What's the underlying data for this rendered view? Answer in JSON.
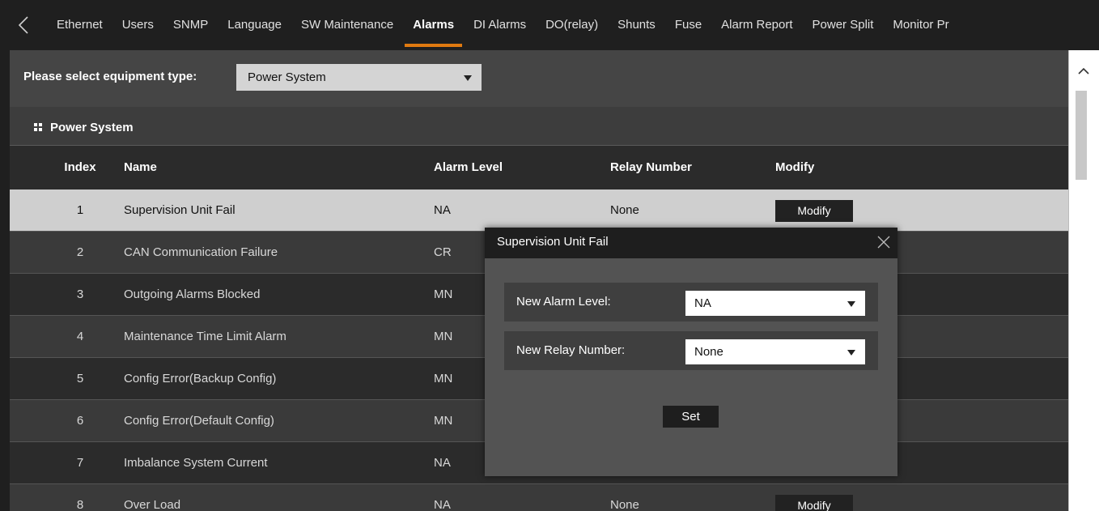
{
  "nav": {
    "tabs": [
      {
        "label": "Ethernet",
        "active": false
      },
      {
        "label": "Users",
        "active": false
      },
      {
        "label": "SNMP",
        "active": false
      },
      {
        "label": "Language",
        "active": false
      },
      {
        "label": "SW Maintenance",
        "active": false
      },
      {
        "label": "Alarms",
        "active": true
      },
      {
        "label": "DI Alarms",
        "active": false
      },
      {
        "label": "DO(relay)",
        "active": false
      },
      {
        "label": "Shunts",
        "active": false
      },
      {
        "label": "Fuse",
        "active": false
      },
      {
        "label": "Alarm Report",
        "active": false
      },
      {
        "label": "Power Split",
        "active": false
      },
      {
        "label": "Monitor Pr",
        "active": false
      }
    ],
    "accent_color": "#e07a10"
  },
  "equipment": {
    "label": "Please select equipment type:",
    "selected": "Power System"
  },
  "section": {
    "title": "Power System"
  },
  "table": {
    "headers": {
      "index": "Index",
      "name": "Name",
      "alarm_level": "Alarm Level",
      "relay_number": "Relay Number",
      "modify": "Modify"
    },
    "rows": [
      {
        "index": "1",
        "name": "Supervision Unit Fail",
        "level": "NA",
        "relay": "None",
        "modify": "Modify"
      },
      {
        "index": "2",
        "name": "CAN Communication Failure",
        "level": "CR",
        "relay": "",
        "modify": ""
      },
      {
        "index": "3",
        "name": "Outgoing Alarms Blocked",
        "level": "MN",
        "relay": "",
        "modify": ""
      },
      {
        "index": "4",
        "name": "Maintenance Time Limit Alarm",
        "level": "MN",
        "relay": "",
        "modify": ""
      },
      {
        "index": "5",
        "name": "Config Error(Backup Config)",
        "level": "MN",
        "relay": "",
        "modify": ""
      },
      {
        "index": "6",
        "name": "Config Error(Default Config)",
        "level": "MN",
        "relay": "",
        "modify": ""
      },
      {
        "index": "7",
        "name": "Imbalance System Current",
        "level": "NA",
        "relay": "",
        "modify": ""
      },
      {
        "index": "8",
        "name": "Over Load",
        "level": "NA",
        "relay": "None",
        "modify": "Modify"
      }
    ]
  },
  "dialog": {
    "title": "Supervision Unit Fail",
    "alarm_level_label": "New Alarm Level:",
    "alarm_level_value": "NA",
    "relay_label": "New Relay Number:",
    "relay_value": "None",
    "set_label": "Set"
  },
  "icons": {
    "back": "chevron-left-icon",
    "section": "grid-icon",
    "close": "close-icon",
    "scroll_up": "chevron-up-icon",
    "dropdown": "caret-down-icon"
  }
}
